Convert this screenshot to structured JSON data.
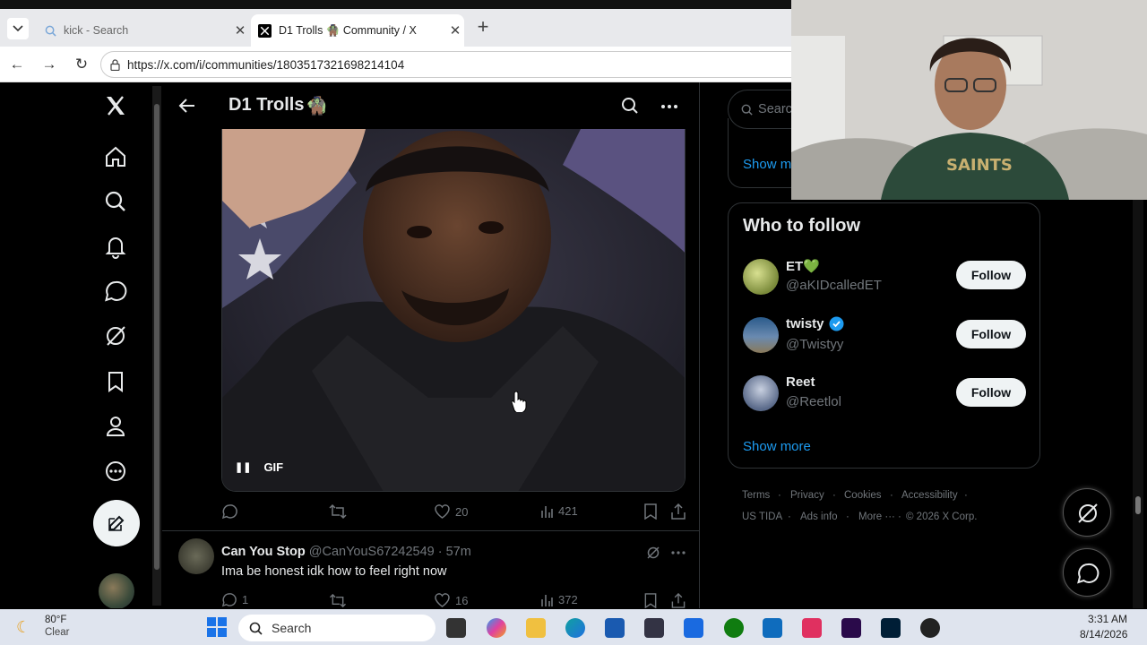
{
  "browser": {
    "tabs": [
      {
        "title": "kick - Search"
      },
      {
        "title": "D1 Trolls 🧌 Community / X"
      }
    ],
    "url": "https://x.com/i/communities/1803517321698214104"
  },
  "header": {
    "title": "D1 Trolls",
    "title_emoji": "🧌"
  },
  "post": {
    "gif_label": "GIF",
    "likes": "20",
    "views": "421"
  },
  "reply": {
    "name": "Can You Stop",
    "handle": "@CanYouS67242549",
    "time": "· 57m",
    "text": "Ima be honest idk how to feel right now",
    "replies": "1",
    "likes": "16",
    "views": "372"
  },
  "right": {
    "search_placeholder": "Search",
    "show_more_top": "Show more",
    "who_to_follow": {
      "title": "Who to follow",
      "users": [
        {
          "name": "ET💚",
          "handle": "@aKIDcalledET",
          "button": "Follow"
        },
        {
          "name": "twisty",
          "handle": "@Twistyy",
          "button": "Follow"
        },
        {
          "name": "Reet",
          "handle": "@Reetlol",
          "button": "Follow"
        }
      ],
      "show_more": "Show more"
    },
    "footer": {
      "terms": "Terms",
      "privacy": "Privacy",
      "cookies": "Cookies",
      "accessibility": "Accessibility",
      "ustida": "US TIDA",
      "ads_info": "Ads info",
      "more": "More ···",
      "copyright": "© 2026 X Corp."
    }
  },
  "taskbar": {
    "weather_temp": "80°F",
    "weather_desc": "Clear",
    "search_label": "Search",
    "time": "3:31 AM",
    "date": "8/14/2026"
  },
  "colors": {
    "accent": "#1d9bf0",
    "verified": "#1d9bf0",
    "text_primary": "#e7e9ea",
    "text_secondary": "#71767b"
  }
}
